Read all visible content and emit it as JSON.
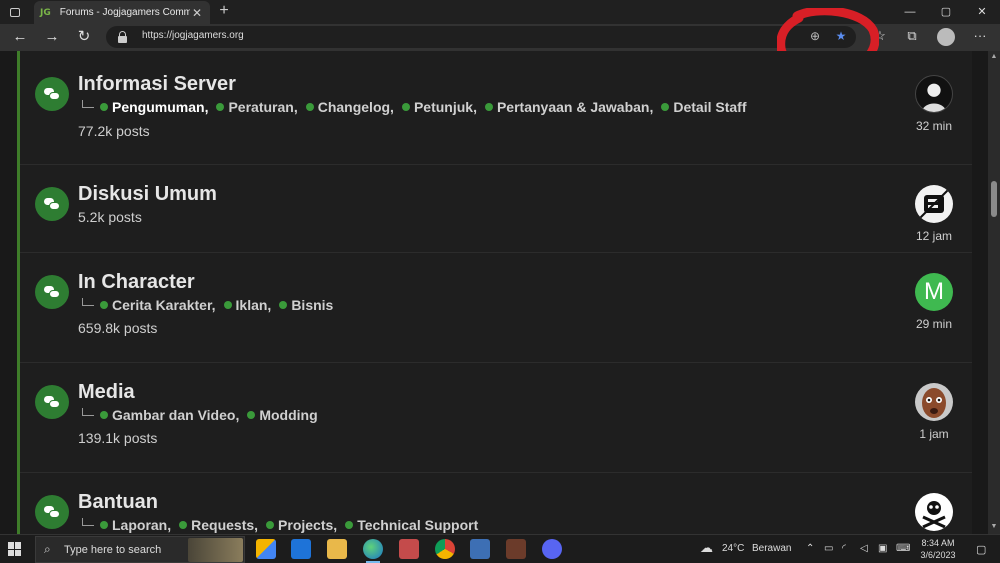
{
  "browser": {
    "tab_favicon": "JG",
    "tab_title": "Forums - Jogjagamers Communi",
    "tab_close": "✕",
    "new_tab": "+",
    "window_controls": [
      "—",
      "▢",
      "✕"
    ],
    "url": "https://jogjagamers.org",
    "icons": [
      "back-icon",
      "forward-icon",
      "refresh-icon",
      "lock-icon",
      "zoom-icon",
      "favorite-star-icon",
      "favorites-icon",
      "collections-icon",
      "profile-icon",
      "more-icon"
    ]
  },
  "forums": [
    {
      "title": "Informasi Server",
      "subforums": [
        "Pengumuman,",
        "Peraturan,",
        "Changelog,",
        "Petunjuk,",
        "Pertanyaan & Jawaban,",
        "Detail Staff"
      ],
      "posts": "77.2k posts",
      "last_post_time": "32 min"
    },
    {
      "title": "Diskusi Umum",
      "subforums": [],
      "posts": "5.2k posts",
      "last_post_time": "12 jam"
    },
    {
      "title": "In Character",
      "subforums": [
        "Cerita Karakter,",
        "Iklan,",
        "Bisnis"
      ],
      "posts": "659.8k posts",
      "last_post_time": "29 min",
      "avatar_letter": "M"
    },
    {
      "title": "Media",
      "subforums": [
        "Gambar dan Video,",
        "Modding"
      ],
      "posts": "139.1k posts",
      "last_post_time": "1 jam"
    },
    {
      "title": "Bantuan",
      "subforums": [
        "Laporan,",
        "Requests,",
        "Projects,",
        "Technical Support"
      ],
      "posts": "",
      "last_post_time": ""
    }
  ],
  "taskbar": {
    "search_placeholder": "Type here to search",
    "weather": "24°C",
    "weather_desc": "Berawan",
    "time": "8:34 AM",
    "date": "3/6/2023"
  },
  "colors": {
    "accent_green": "#2e7d32",
    "annotation_red": "#d81f26",
    "background": "#1e1e1e"
  }
}
